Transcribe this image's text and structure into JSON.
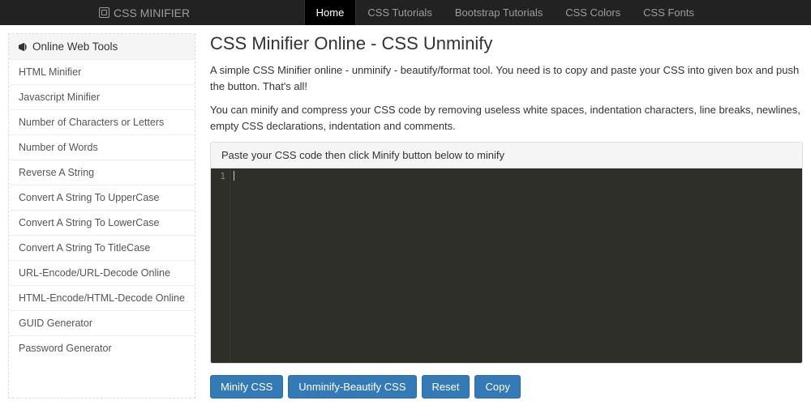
{
  "navbar": {
    "brand": "CSS MINIFIER",
    "items": [
      {
        "label": "Home",
        "active": true
      },
      {
        "label": "CSS Tutorials",
        "active": false
      },
      {
        "label": "Bootstrap Tutorials",
        "active": false
      },
      {
        "label": "CSS Colors",
        "active": false
      },
      {
        "label": "CSS Fonts",
        "active": false
      }
    ]
  },
  "sidebar": {
    "header": "Online Web Tools",
    "items": [
      "HTML Minifier",
      "Javascript Minifier",
      "Number of Characters or Letters",
      "Number of Words",
      "Reverse A String",
      "Convert A String To UpperCase",
      "Convert A String To LowerCase",
      "Convert A String To TitleCase",
      "URL-Encode/URL-Decode Online",
      "HTML-Encode/HTML-Decode Online",
      "GUID Generator",
      "Password Generator"
    ]
  },
  "main": {
    "title": "CSS Minifier Online - CSS Unminify",
    "desc1": "A simple CSS Minifier online - unminify - beautify/format tool. You need is to copy and paste your CSS into given box and push the button. That's all!",
    "desc2": "You can minify and compress your CSS code by removing useless white spaces, indentation characters, line breaks, newlines, empty CSS declarations, indentation and comments.",
    "panel_heading": "Paste your CSS code then click Minify button below to minify",
    "editor": {
      "line_number": "1"
    },
    "buttons": {
      "minify": "Minify CSS",
      "unminify": "Unminify-Beautify CSS",
      "reset": "Reset",
      "copy": "Copy"
    }
  }
}
